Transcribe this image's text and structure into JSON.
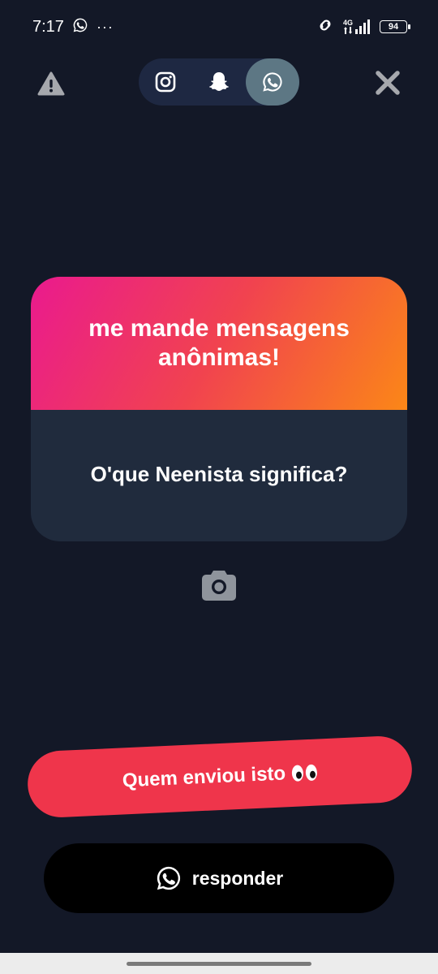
{
  "status_bar": {
    "time": "7:17",
    "network": "4G",
    "battery": "94"
  },
  "top_bar": {
    "share_options": [
      {
        "icon": "instagram-icon",
        "active": false
      },
      {
        "icon": "snapchat-icon",
        "active": false
      },
      {
        "icon": "whatsapp-icon",
        "active": true
      }
    ]
  },
  "card": {
    "title": "me mande mensagens anônimas!",
    "question": "O'que Neenista significa?"
  },
  "buttons": {
    "who_sent": "Quem enviou isto",
    "reply": "responder"
  },
  "colors": {
    "background": "#131827",
    "card_body": "#202b3d",
    "gradient_start": "#ea1a8e",
    "gradient_end": "#fb8717",
    "who_button": "#ef354b",
    "reply_button": "#000000",
    "active_share": "#5d7784"
  }
}
